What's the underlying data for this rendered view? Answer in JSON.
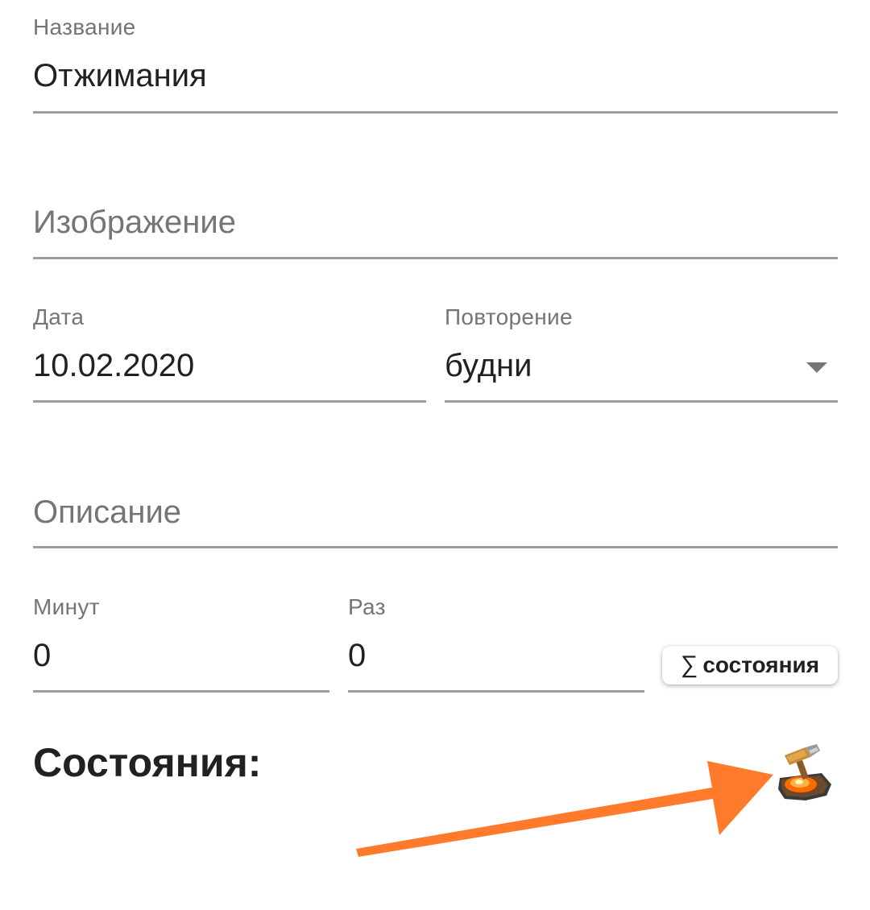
{
  "form": {
    "name": {
      "label": "Название",
      "value": "Отжимания"
    },
    "image": {
      "placeholder": "Изображение"
    },
    "date": {
      "label": "Дата",
      "value": "10.02.2020"
    },
    "repeat": {
      "label": "Повторение",
      "value": "будни"
    },
    "description": {
      "placeholder": "Описание"
    },
    "minutes": {
      "label": "Минут",
      "value": "0"
    },
    "times": {
      "label": "Раз",
      "value": "0"
    }
  },
  "states_button": {
    "icon": "∑",
    "label": "состояния"
  },
  "states_section": {
    "title": "Состояния:"
  },
  "icons": {
    "dropdown": "chevron-down-icon",
    "anvil": "anvil-hammer-icon",
    "annotation_arrow": "arrow-annotation"
  },
  "colors": {
    "label": "#757575",
    "text": "#212121",
    "underline": "#9e9e9e",
    "arrow": "#ff7a2a"
  }
}
